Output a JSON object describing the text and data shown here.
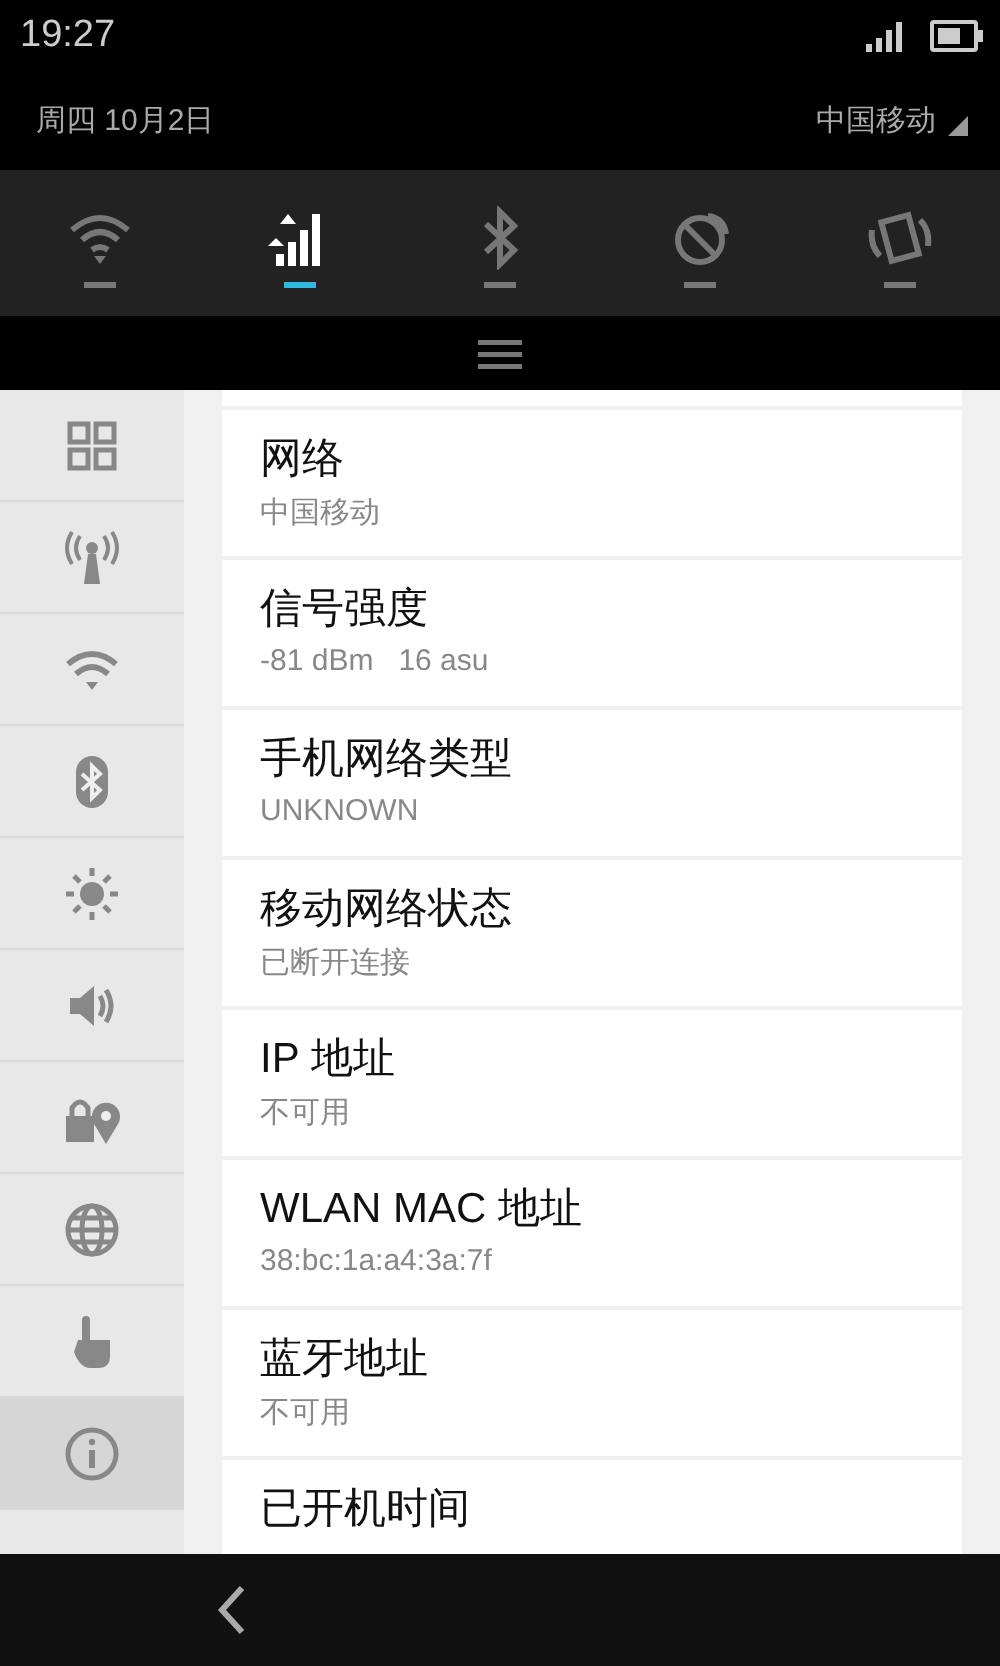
{
  "status_bar": {
    "time": "19:27"
  },
  "header": {
    "date": "周四  10月2日",
    "carrier": "中国移动"
  },
  "toggles": [
    {
      "kind": "wifi",
      "on": false
    },
    {
      "kind": "data",
      "on": true
    },
    {
      "kind": "bluetooth",
      "on": false
    },
    {
      "kind": "gps",
      "on": false
    },
    {
      "kind": "rotate",
      "on": false
    }
  ],
  "sidebar": {
    "items": [
      {
        "kind": "grid",
        "selected": false
      },
      {
        "kind": "antenna",
        "selected": false
      },
      {
        "kind": "wifi",
        "selected": false
      },
      {
        "kind": "bluetooth",
        "selected": false
      },
      {
        "kind": "brightness",
        "selected": false
      },
      {
        "kind": "sound",
        "selected": false
      },
      {
        "kind": "lock",
        "selected": false
      },
      {
        "kind": "globe",
        "selected": false
      },
      {
        "kind": "hand",
        "selected": false
      },
      {
        "kind": "info",
        "selected": true
      }
    ]
  },
  "list": [
    {
      "title": "网络",
      "value": "中国移动"
    },
    {
      "title": "信号强度",
      "value": "-81 dBm   16 asu"
    },
    {
      "title": "手机网络类型",
      "value": "UNKNOWN"
    },
    {
      "title": "移动网络状态",
      "value": "已断开连接"
    },
    {
      "title": "IP 地址",
      "value": "不可用"
    },
    {
      "title": "WLAN MAC 地址",
      "value": "38:bc:1a:a4:3a:7f"
    },
    {
      "title": "蓝牙地址",
      "value": "不可用"
    },
    {
      "title": "已开机时间"
    }
  ]
}
